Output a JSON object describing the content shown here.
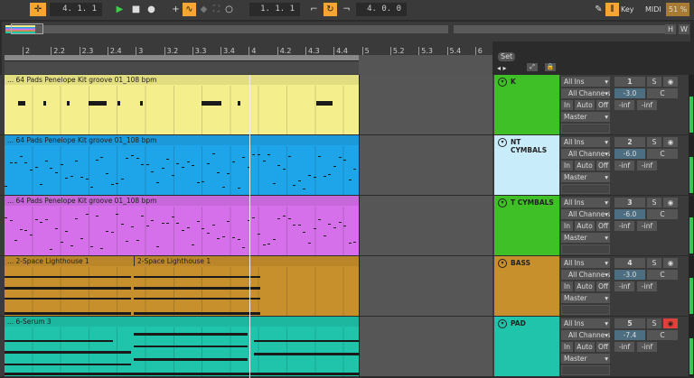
{
  "toolbar": {
    "arrangement_position": "4. 1. 1",
    "loop_start": "1. 1. 1",
    "loop_length": "4. 0. 0",
    "key_label": "Key",
    "midi_label": "MIDI",
    "cpu": "51 %"
  },
  "overview": {
    "h_label": "H",
    "w_label": "W"
  },
  "ruler": {
    "ticks": [
      "2",
      "2.2",
      "2.3",
      "2.4",
      "3",
      "3.2",
      "3.3",
      "3.4",
      "4",
      "4.2",
      "4.3",
      "4.4",
      "5",
      "5.2",
      "5.3",
      "5.4",
      "6"
    ],
    "set_label": "Set"
  },
  "tracks": [
    {
      "clips": [
        "... 64 Pads Penelope Kit groove 01_108 bpm"
      ],
      "name": "K",
      "color": "#f4ee8c",
      "head": "#3ec026",
      "input": "All Ins",
      "channel": "All Channels",
      "monitor": "Off",
      "output": "Master",
      "number": "1",
      "solo": "S",
      "volume": "-3.0",
      "pan": "C",
      "peak_l": "-inf",
      "peak_r": "-inf",
      "in": "In",
      "auto": "Auto",
      "off": "Off"
    },
    {
      "clips": [
        "... 64 Pads Penelope Kit groove 01_108 bpm"
      ],
      "name": "NT CYMBALS",
      "color": "#1ea4e8",
      "head": "#c9ecfb",
      "input": "All Ins",
      "channel": "All Channels",
      "monitor": "Off",
      "output": "Master",
      "number": "2",
      "solo": "S",
      "volume": "-6.0",
      "pan": "C",
      "peak_l": "-inf",
      "peak_r": "-inf",
      "in": "In",
      "auto": "Auto",
      "off": "Off"
    },
    {
      "clips": [
        "... 64 Pads Penelope Kit groove 01_108 bpm"
      ],
      "name": "T CYMBALS",
      "color": "#d670ea",
      "head": "#3ec026",
      "input": "All Ins",
      "channel": "All Channels",
      "monitor": "Off",
      "output": "Master",
      "number": "3",
      "solo": "S",
      "volume": "-6.0",
      "pan": "C",
      "peak_l": "-inf",
      "peak_r": "-inf",
      "in": "In",
      "auto": "Auto",
      "off": "Off"
    },
    {
      "clips": [
        "... 2-Space Lighthouse 1",
        "2-Space Lighthouse 1"
      ],
      "name": "BASS",
      "color": "#c8902c",
      "head": "#c8902c",
      "input": "All Ins",
      "channel": "All Channels",
      "monitor": "Auto",
      "output": "Master",
      "number": "4",
      "solo": "S",
      "volume": "-3.0",
      "pan": "C",
      "peak_l": "-inf",
      "peak_r": "-inf",
      "in": "In",
      "auto": "Auto",
      "off": "Off"
    },
    {
      "clips": [
        "... 6-Serum 3"
      ],
      "name": "PAD",
      "color": "#1fc4aa",
      "head": "#1fc4aa",
      "input": "All Ins",
      "channel": "All Channels",
      "monitor": "Auto",
      "output": "Master",
      "number": "5",
      "solo": "S",
      "volume": "-7.4",
      "pan": "C",
      "peak_l": "-inf",
      "peak_r": "-inf",
      "in": "In",
      "auto": "Auto",
      "off": "Off",
      "armed": true
    }
  ]
}
